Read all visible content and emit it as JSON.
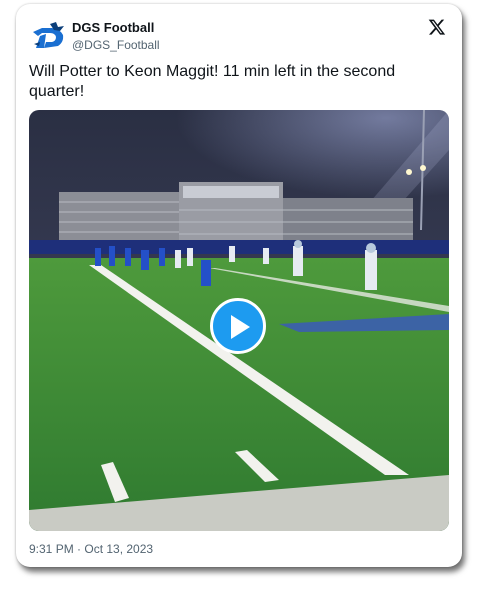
{
  "account": {
    "display_name": "DGS Football",
    "handle": "@DGS_Football",
    "avatar_icon": "dgs-mustang-logo-icon",
    "platform_icon": "x-logo-icon"
  },
  "tweet": {
    "text": "Will Potter to Keon Maggit! 11 min left in the second quarter!",
    "timestamp": "9:31 PM · Oct 13, 2023"
  },
  "media": {
    "type": "video",
    "description_icon": "play-icon"
  },
  "colors": {
    "accent": "#1d9bf0",
    "text_primary": "#0f1419",
    "text_secondary": "#536471",
    "field_green": "#3f8a3a"
  }
}
